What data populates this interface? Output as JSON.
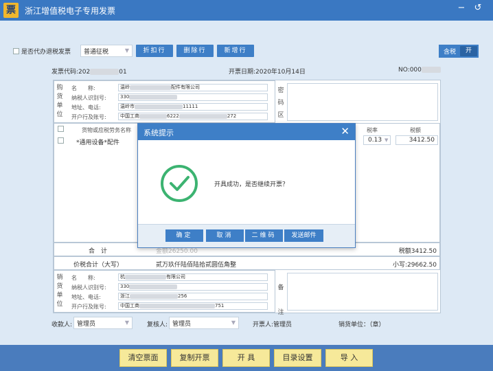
{
  "window": {
    "logo_text": "票",
    "title": "浙江增值税电子专用发票",
    "minimize_icon": "−",
    "restore_icon": "↺"
  },
  "toolbar": {
    "proxy_label": "是否代办退税发票",
    "levy_type": "普通征税",
    "discount_line": "折扣行",
    "delete_line": "删除行",
    "add_line": "新增行",
    "tax_included_label": "含税",
    "tax_included_state": "开"
  },
  "invoice": {
    "code_label": "发票代码:202",
    "code_tail": "01",
    "date_label": "开票日期:2020年10月14日",
    "number_label": "NO:000",
    "buyer": {
      "section_label": [
        "购",
        "货",
        "单",
        "位"
      ],
      "name_label": "名　　称:",
      "name_value_head": "温岭",
      "name_value_tail": "配件有限公司",
      "taxid_label": "纳税人识别号:",
      "taxid_value": "330",
      "addr_label": "地址、电话:",
      "addr_value_head": "温岭市",
      "addr_value_tail": "11111",
      "bank_label": "开户行及账号:",
      "bank_value_head": "中国工商",
      "bank_value_mid": "6222",
      "bank_value_tail": "272"
    },
    "cipher_label": [
      "密",
      "码",
      "区"
    ],
    "table": {
      "col_item": "货物或应税劳务名称",
      "col_rate": "税率",
      "col_tax": "税额",
      "row_item": "*通用设备*配件",
      "row_rate": "0.13",
      "row_tax": "3412.50"
    },
    "total_label": "合　计",
    "total_amount": "金额26250.00",
    "total_tax": "税额3412.50",
    "grand_label": "价税合计（大写）",
    "grand_words": "贰万玖仟陆佰陆拾贰圆伍角整",
    "grand_small": "小写:29662.50",
    "seller": {
      "section_label": [
        "销",
        "货",
        "单",
        "位"
      ],
      "name_label": "名　　称:",
      "name_value_head": "杭",
      "name_value_tail": "有限公司",
      "taxid_label": "纳税人识别号:",
      "taxid_value": "330",
      "addr_label": "地址、电话:",
      "addr_value_head": "浙江",
      "addr_value_tail": "256",
      "bank_label": "开户行及账号:",
      "bank_value_head": "中国工商",
      "bank_value_tail": "751"
    },
    "remark_label": [
      "备",
      "注"
    ]
  },
  "footer": {
    "payee_label": "收款人:",
    "payee_value": "管理员",
    "reviewer_label": "复核人:",
    "reviewer_value": "管理员",
    "drawer": "开票人:管理员",
    "seller_seal": "销货单位：（章）"
  },
  "dialog": {
    "title": "系统提示",
    "close_icon": "✕",
    "message": "开具成功，是否继续开票？",
    "ok": "确定",
    "cancel": "取消",
    "qrcode": "二维码",
    "email": "发送邮件"
  },
  "bottom": {
    "clear": "清空票面",
    "copy": "复制开票",
    "issue": "开 具",
    "catalog": "目录设置",
    "import": "导 入"
  },
  "colors": {
    "accent": "#3e7fc7",
    "success": "#3cb371",
    "bottom_button": "#f6e99a"
  }
}
